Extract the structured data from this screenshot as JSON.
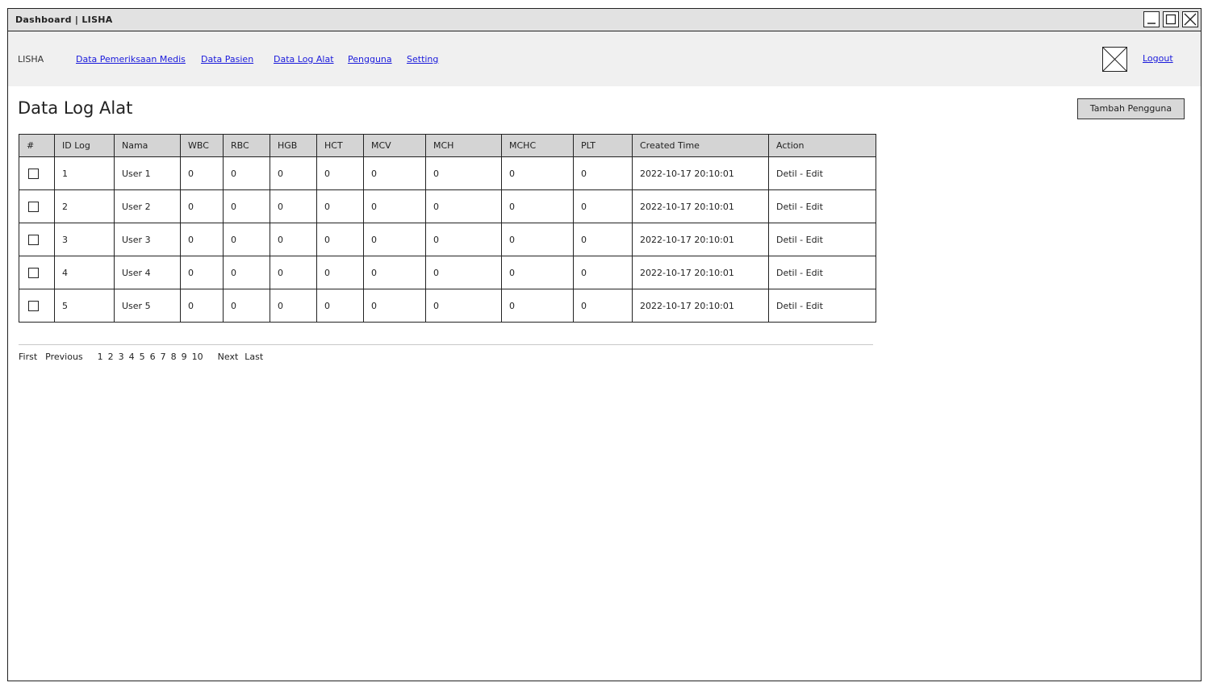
{
  "window": {
    "title": "Dashboard | LISHA"
  },
  "navbar": {
    "brand": "LISHA",
    "links": [
      "Data Pemeriksaan Medis",
      "Data Pasien",
      "Data Log Alat",
      "Pengguna",
      "Setting"
    ],
    "logout": "Logout"
  },
  "page": {
    "title": "Data Log Alat",
    "add_button": "Tambah Pengguna"
  },
  "table": {
    "headers": [
      "#",
      "ID Log",
      "Nama",
      "WBC",
      "RBC",
      "HGB",
      "HCT",
      "MCV",
      "MCH",
      "MCHC",
      "PLT",
      "Created Time",
      "Action"
    ],
    "rows": [
      [
        "",
        "1",
        "User 1",
        "0",
        "0",
        "0",
        "0",
        "0",
        "0",
        "0",
        "0",
        "2022-10-17 20:10:01",
        "Detil - Edit"
      ],
      [
        "",
        "2",
        "User 2",
        "0",
        "0",
        "0",
        "0",
        "0",
        "0",
        "0",
        "0",
        "2022-10-17 20:10:01",
        "Detil - Edit"
      ],
      [
        "",
        "3",
        "User 3",
        "0",
        "0",
        "0",
        "0",
        "0",
        "0",
        "0",
        "0",
        "2022-10-17 20:10:01",
        "Detil - Edit"
      ],
      [
        "",
        "4",
        "User 4",
        "0",
        "0",
        "0",
        "0",
        "0",
        "0",
        "0",
        "0",
        "2022-10-17 20:10:01",
        "Detil - Edit"
      ],
      [
        "",
        "5",
        "User 5",
        "0",
        "0",
        "0",
        "0",
        "0",
        "0",
        "0",
        "0",
        "2022-10-17 20:10:01",
        "Detil - Edit"
      ]
    ]
  },
  "pagination": {
    "first": "First",
    "previous": "Previous",
    "pages": [
      "1",
      "2",
      "3",
      "4",
      "5",
      "6",
      "7",
      "8",
      "9",
      "10"
    ],
    "next": "Next",
    "last": "Last"
  }
}
